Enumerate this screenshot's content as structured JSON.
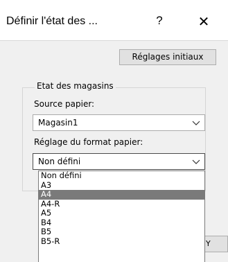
{
  "window": {
    "title": "Définir l'état des ...",
    "help_label": "?",
    "close_label": "✕"
  },
  "reset_button": {
    "label": "Réglages initiaux"
  },
  "group": {
    "label": "Etat des magasins"
  },
  "source": {
    "label": "Source papier:",
    "value": "Magasin1"
  },
  "format": {
    "label": "Réglage du format papier:",
    "value": "Non défini",
    "options": [
      "Non défini",
      "A3",
      "A4",
      "A4-R",
      "A5",
      "B4",
      "B5",
      "B5-R"
    ],
    "selected_index": 2
  },
  "partially_hidden_button": {
    "label": "Y"
  }
}
